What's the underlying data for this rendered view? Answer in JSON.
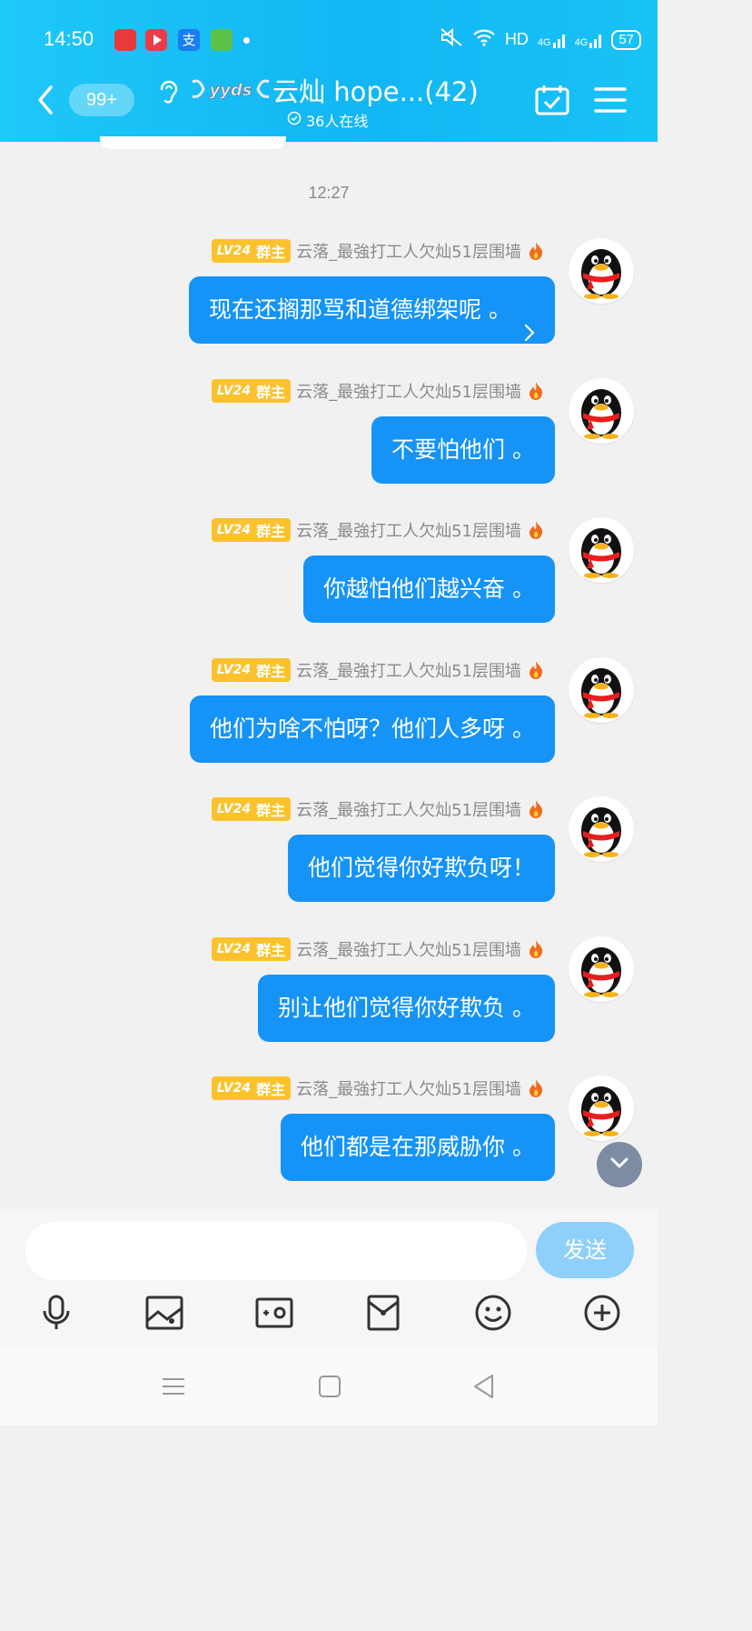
{
  "status_bar": {
    "time": "14:50",
    "network": "HD",
    "signal_1": "4G",
    "signal_2": "4G",
    "battery": "57"
  },
  "header": {
    "unread_badge": "99+",
    "group_tag": "yyds",
    "title": "云灿 hope...(42)",
    "online": "36人在线"
  },
  "time_separator": "12:27",
  "messages": [
    {
      "level": "LV24",
      "role": "群主",
      "nickname": "云落_最強打工人欠灿51层围墙",
      "text": "现在还搁那骂和道德绑架呢 。",
      "has_chevron": true
    },
    {
      "level": "LV24",
      "role": "群主",
      "nickname": "云落_最強打工人欠灿51层围墙",
      "text": "不要怕他们 。"
    },
    {
      "level": "LV24",
      "role": "群主",
      "nickname": "云落_最強打工人欠灿51层围墙",
      "text": "你越怕他们越兴奋 。"
    },
    {
      "level": "LV24",
      "role": "群主",
      "nickname": "云落_最強打工人欠灿51层围墙",
      "text": "他们为啥不怕呀？他们人多呀 。"
    },
    {
      "level": "LV24",
      "role": "群主",
      "nickname": "云落_最強打工人欠灿51层围墙",
      "text": "他们觉得你好欺负呀！"
    },
    {
      "level": "LV24",
      "role": "群主",
      "nickname": "云落_最強打工人欠灿51层围墙",
      "text": "别让他们觉得你好欺负 。"
    },
    {
      "level": "LV24",
      "role": "群主",
      "nickname": "云落_最強打工人欠灿51层围墙",
      "text": "他们都是在那威胁你 。"
    }
  ],
  "input": {
    "value": "",
    "placeholder": "",
    "send_label": "发送"
  },
  "toolbar": {
    "items": [
      "microphone-icon",
      "image-icon",
      "camera-icon",
      "red-packet-icon",
      "emoji-icon",
      "plus-icon"
    ]
  },
  "colors": {
    "header": "#12b6f4",
    "bubble": "#1593f6",
    "level_badge": "#fbc22d",
    "send_button": "#8fd0fb"
  }
}
